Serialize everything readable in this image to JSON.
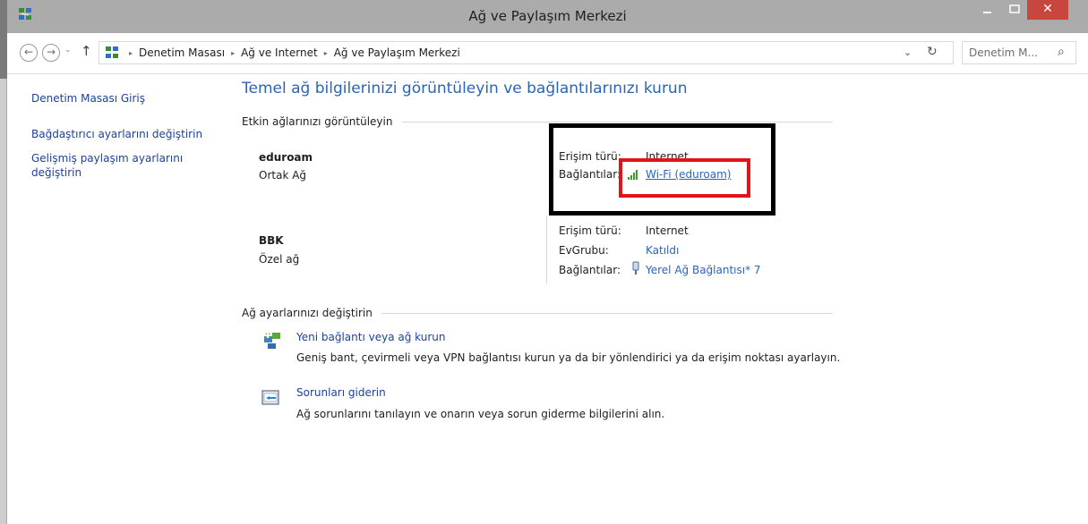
{
  "window": {
    "title": "Ağ ve Paylaşım Merkezi",
    "close_glyph": "✕",
    "icons": {
      "app": "network-center-icon",
      "minimize": "minimize-icon",
      "maximize": "maximize-icon",
      "close": "close-icon"
    }
  },
  "address_bar": {
    "back_glyph": "←",
    "forward_glyph": "→",
    "dropdown_glyph": "⌄",
    "up_glyph": "↑",
    "breadcrumbs": [
      "Denetim Masası",
      "Ağ ve Internet",
      "Ağ ve Paylaşım Merkezi"
    ],
    "breadcrumb_separator": "▸",
    "address_dropdown_glyph": "⌄",
    "refresh_glyph": "↻",
    "search_placeholder": "Denetim M...",
    "search_glyph": "⌕"
  },
  "sidebar": {
    "items": [
      {
        "label": "Denetim Masası Giriş"
      },
      {
        "label": "Bağdaştırıcı ayarlarını değiştirin"
      },
      {
        "label": "Gelişmiş paylaşım ayarlarını değiştirin"
      }
    ]
  },
  "main": {
    "title": "Temel ağ bilgilerinizi görüntüleyin ve bağlantılarınızı kurun",
    "active_networks_heading": "Etkin ağlarınızı görüntüleyin",
    "networks": [
      {
        "name": "eduroam",
        "type": "Ortak Ağ",
        "access_type_label": "Erişim türü:",
        "access_type_value": "Internet",
        "connections_label": "Bağlantılar:",
        "connection_link": "Wi-Fi (eduroam)",
        "connection_icon": "wifi-signal-icon"
      },
      {
        "name": "BBK",
        "type": "Özel ağ",
        "access_type_label": "Erişim türü:",
        "access_type_value": "Internet",
        "homegroup_label": "EvGrubu:",
        "homegroup_value": "Katıldı",
        "connections_label": "Bağlantılar:",
        "connection_link": "Yerel Ağ Bağlantısı* 7",
        "connection_icon": "ethernet-adapter-icon"
      }
    ],
    "change_settings_heading": "Ağ ayarlarınızı değiştirin",
    "tasks": [
      {
        "link": "Yeni bağlantı veya ağ kurun",
        "description": "Geniş bant, çevirmeli veya VPN bağlantısı kurun ya da bir yönlendirici ya da erişim noktası ayarlayın.",
        "icon": "new-connection-icon"
      },
      {
        "link": "Sorunları giderin",
        "description": "Ağ sorunlarını tanılayın ve onarın veya sorun giderme bilgilerini alın.",
        "icon": "troubleshoot-icon"
      }
    ]
  },
  "colors": {
    "title_bar": "#ababab",
    "close_button": "#c7463d",
    "link": "#2a65b8",
    "highlight_black": "#000000",
    "highlight_red": "#e0141b"
  }
}
